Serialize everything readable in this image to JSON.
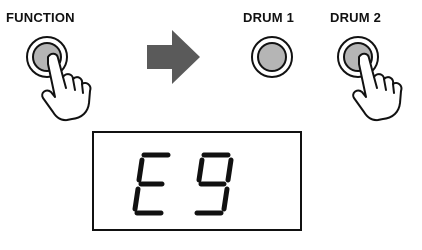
{
  "labels": {
    "function": "FUNCTION",
    "drum1": "DRUM 1",
    "drum2": "DRUM 2"
  },
  "display": {
    "text": "E9"
  },
  "icons": {
    "function_button": "pressed-round-button-icon",
    "function_hand": "pressing-hand-icon",
    "arrow": "right-arrow-icon",
    "drum1_button": "round-button-icon",
    "drum2_button": "pressed-round-button-icon",
    "drum2_hand": "pressing-hand-icon"
  },
  "colors": {
    "ink": "#111111",
    "arrow": "#5a5a5a",
    "button_fill": "#b5b5b5"
  }
}
